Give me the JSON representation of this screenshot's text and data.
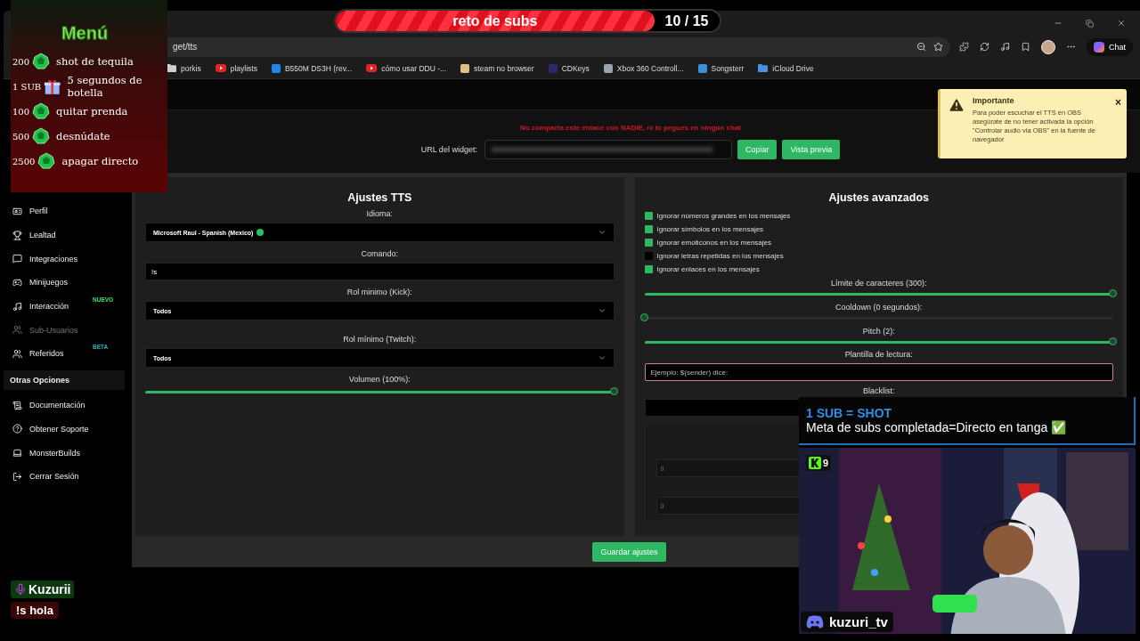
{
  "browser": {
    "address": "get/tts",
    "bookmarks": [
      {
        "label": "porkis",
        "kind": "folder",
        "color": "#cfcfcf"
      },
      {
        "label": "playlists",
        "kind": "video",
        "color": "#e02424"
      },
      {
        "label": "B550M DS3H (rev...",
        "kind": "site",
        "color": "#1e88e5"
      },
      {
        "label": "cómo usar DDU -...",
        "kind": "video",
        "color": "#e02424"
      },
      {
        "label": "steam no browser",
        "kind": "site",
        "color": "#e0c080"
      },
      {
        "label": "CDKeys",
        "kind": "site",
        "color": "#2a2a6a"
      },
      {
        "label": "Xbox 360 Controll...",
        "kind": "site",
        "color": "#9aa4b0"
      },
      {
        "label": "Songsterr",
        "kind": "site",
        "color": "#3b8fe0"
      },
      {
        "label": "iCloud Drive",
        "kind": "folder",
        "color": "#4a90e2"
      }
    ],
    "chat_button": "Chat"
  },
  "sidebar": {
    "items": [
      {
        "label": "Perfil",
        "disabled": false
      },
      {
        "label": "Lealtad",
        "disabled": false
      },
      {
        "label": "Integraciones",
        "disabled": false
      },
      {
        "label": "Minijuegos",
        "disabled": false
      },
      {
        "label": "Interacción",
        "disabled": false,
        "badge": {
          "text": "NUEVO",
          "color": "#2ee86a"
        }
      },
      {
        "label": "Sub-Usuarios",
        "disabled": true
      },
      {
        "label": "Referidos",
        "disabled": false,
        "badge": {
          "text": "BETA",
          "color": "#2ab0c0"
        }
      }
    ],
    "section": "Otras Opciones",
    "section_items": [
      {
        "label": "Documentación",
        "disabled": false
      },
      {
        "label": "Obtener Soporte",
        "disabled": false
      },
      {
        "label": "MonsterBuilds",
        "disabled": false
      },
      {
        "label": "Cerrar Sesión",
        "disabled": false
      }
    ]
  },
  "widget": {
    "warning": "No comparta este enlace con NADIE, ni lo pegues en ningún chat",
    "url_label": "URL del widget:",
    "copy_button": "Copiar",
    "preview_button": "Vista previa"
  },
  "tts_settings": {
    "title": "Ajustes TTS",
    "fields": [
      {
        "label": "Idioma:",
        "kind": "select",
        "value": "Microsoft Raul - Spanish (Mexico)",
        "online": true
      },
      {
        "label": "Comando:",
        "kind": "input",
        "value": "!s"
      },
      {
        "label": "Rol minimo (Kick):",
        "kind": "select",
        "value": "Todos"
      },
      {
        "label": "Rol mínimo (Twitch):",
        "kind": "select",
        "value": "Todos"
      },
      {
        "label": "Volumen (100%):",
        "kind": "slider",
        "level": 1
      }
    ]
  },
  "advanced_settings": {
    "title": "Ajustes avanzados",
    "options": [
      {
        "label": "Ignorar números grandes en los mensajes",
        "checked": true
      },
      {
        "label": "Ignorar símbolos en los mensajes",
        "checked": true
      },
      {
        "label": "Ignorar emoticonos en los mensajes",
        "checked": true
      },
      {
        "label": "Ignorar letras repetidas en los mensajes",
        "checked": false
      },
      {
        "label": "Ignorar enlaces en los mensajes",
        "checked": true
      }
    ],
    "sliders": [
      {
        "label": "Límite de caracteres (300):",
        "level": 1
      },
      {
        "label": "Cooldown (0 segundos):",
        "level": 0
      },
      {
        "label": "Pitch (2):",
        "level": 1
      }
    ],
    "template": {
      "label": "Plantilla de lectura:",
      "placeholder": "Ejemplo: $(sender) dice:"
    },
    "blacklist_label": "Blacklist:",
    "number_fields": [
      {
        "placeholder": "0"
      },
      {
        "placeholder": "0"
      }
    ]
  },
  "save_button": "Guardar ajustes",
  "toast": {
    "title": "Importante",
    "message": "Para poder escuchar el TTS en OBS asegúrate de no tener activada la opción \"Controlar audio via OBS\" en la fuente de navegador",
    "close": "×"
  },
  "stream_overlays": {
    "goal_bar": {
      "label": "reto de subs",
      "count": "10 / 15",
      "level": 0.83
    },
    "menu": {
      "title": "Menú",
      "items": [
        {
          "cost": "200",
          "kind": "coin",
          "text": "shot de tequila"
        },
        {
          "cost": "1 SUB",
          "kind": "gift",
          "text": "5 segundos de botella"
        },
        {
          "cost": "100",
          "kind": "coin",
          "text": "quitar prenda"
        },
        {
          "cost": "500",
          "kind": "coin",
          "text": "desnúdate"
        },
        {
          "cost": "2500",
          "kind": "coin",
          "text": "apagar directo"
        }
      ]
    },
    "chat_message": {
      "user": "Kuzurii",
      "text": "!s hola"
    },
    "webcam": {
      "headline": "1 SUB = SHOT",
      "goal_text": "Meta de subs completada=Directo en tanga ✅",
      "viewer_count": "9",
      "channel": "kuzuri_tv"
    }
  }
}
